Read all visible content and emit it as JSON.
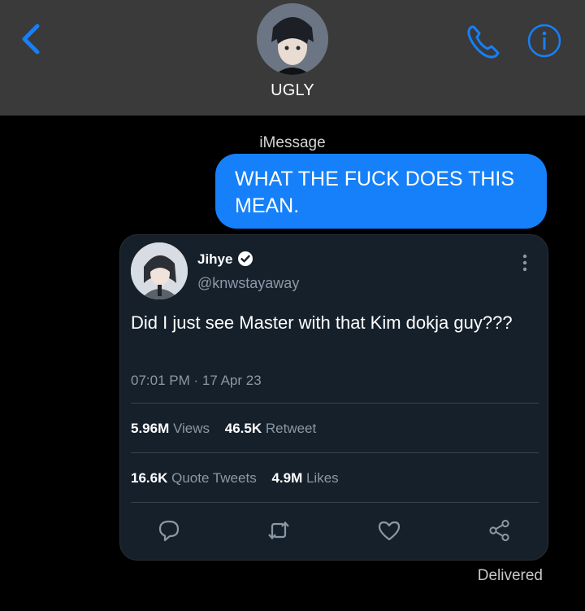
{
  "header": {
    "contact_name": "UGLY"
  },
  "conversation": {
    "service_label": "iMessage",
    "outgoing_message": "WHAT THE FUCK DOES THIS MEAN.",
    "status": "Delivered"
  },
  "tweet": {
    "display_name": "Jihye",
    "handle": "@knwstayaway",
    "text": "Did I just see Master with that Kim dokja guy???",
    "timestamp": "07:01 PM · 17 Apr 23",
    "stats": {
      "views_count": "5.96M",
      "views_label": "Views",
      "retweets_count": "46.5K",
      "retweets_label": "Retweet",
      "quotes_count": "16.6K",
      "quotes_label": "Quote Tweets",
      "likes_count": "4.9M",
      "likes_label": "Likes"
    }
  },
  "colors": {
    "ios_blue": "#1580f9",
    "header_bg": "#3a3a3a",
    "tweet_bg": "#15202b",
    "twitter_verified": "#1d9bf0"
  },
  "icons": [
    "chevron-left-icon",
    "phone-icon",
    "info-icon",
    "verified-badge-icon",
    "more-vertical-icon",
    "reply-icon",
    "retweet-icon",
    "like-icon",
    "share-icon"
  ]
}
